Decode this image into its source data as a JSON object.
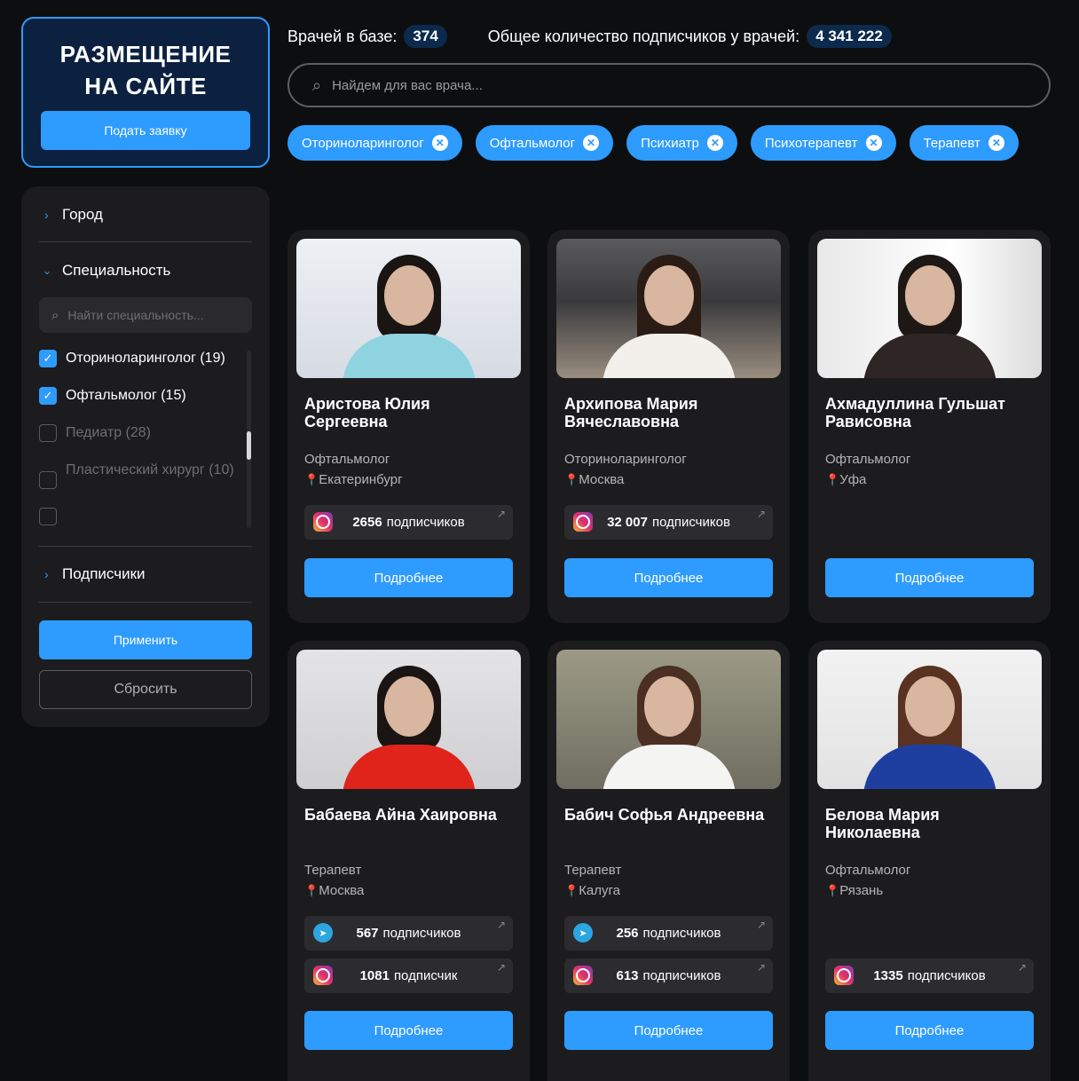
{
  "promo": {
    "title_line1": "РАЗМЕЩЕНИЕ",
    "title_line2": "НА САЙТЕ",
    "button": "Подать заявку"
  },
  "filters": {
    "city_label": "Город",
    "specialty_label": "Специальность",
    "specialty_search_placeholder": "Найти специальность...",
    "specialties": [
      {
        "label": "Оториноларинголог (19)",
        "checked": true
      },
      {
        "label": "Офтальмолог (15)",
        "checked": true
      },
      {
        "label": "Педиатр (28)",
        "checked": false
      },
      {
        "label": "Пластический хирург (10)",
        "checked": false
      },
      {
        "label": "",
        "checked": false
      }
    ],
    "subscribers_label": "Подписчики",
    "apply_button": "Применить",
    "reset_button": "Сбросить"
  },
  "stats": {
    "doctors_label": "Врачей в базе:",
    "doctors_value": "374",
    "subscribers_label": "Общее количество подписчиков у врачей:",
    "subscribers_value": "4 341 222"
  },
  "search": {
    "placeholder": "Найдем для вас врача..."
  },
  "tags": [
    "Оториноларинголог",
    "Офтальмолог",
    "Психиатр",
    "Психотерапевт",
    "Терапевт"
  ],
  "cards": [
    {
      "name": "Аристова Юлия Сергеевна",
      "specialty": "Офтальмолог",
      "city": "Екатеринбург",
      "social": [
        {
          "type": "instagram-icon",
          "count": "2656",
          "label": "подписчиков"
        }
      ],
      "button": "Подробнее"
    },
    {
      "name": "Архипова Мария Вячеславовна",
      "specialty": "Оториноларинголог",
      "city": "Москва",
      "social": [
        {
          "type": "instagram-icon",
          "count": "32 007",
          "label": "подписчиков"
        }
      ],
      "button": "Подробнее"
    },
    {
      "name": "Ахмадуллина Гульшат Рависовна",
      "specialty": "Офтальмолог",
      "city": "Уфа",
      "social": [],
      "button": "Подробнее"
    },
    {
      "name": "Бабаева Айна Хаировна",
      "specialty": "Терапевт",
      "city": "Москва",
      "social": [
        {
          "type": "telegram-icon",
          "count": "567",
          "label": "подписчиков"
        },
        {
          "type": "instagram-icon",
          "count": "1081",
          "label": "подписчик"
        }
      ],
      "button": "Подробнее"
    },
    {
      "name": "Бабич Софья Андреевна",
      "specialty": "Терапевт",
      "city": "Калуга",
      "social": [
        {
          "type": "telegram-icon",
          "count": "256",
          "label": "подписчиков"
        },
        {
          "type": "instagram-icon",
          "count": "613",
          "label": "подписчиков"
        }
      ],
      "button": "Подробнее"
    },
    {
      "name": "Белова Мария Николаевна",
      "specialty": "Офтальмолог",
      "city": "Рязань",
      "social": [
        {
          "type": "instagram-icon",
          "count": "1335",
          "label": "подписчиков"
        }
      ],
      "button": "Подробнее"
    }
  ],
  "colors": {
    "accent": "#2e9bff",
    "background": "#0d0e10",
    "card": "#1c1c1e",
    "promo_bg": "#0c2140"
  }
}
